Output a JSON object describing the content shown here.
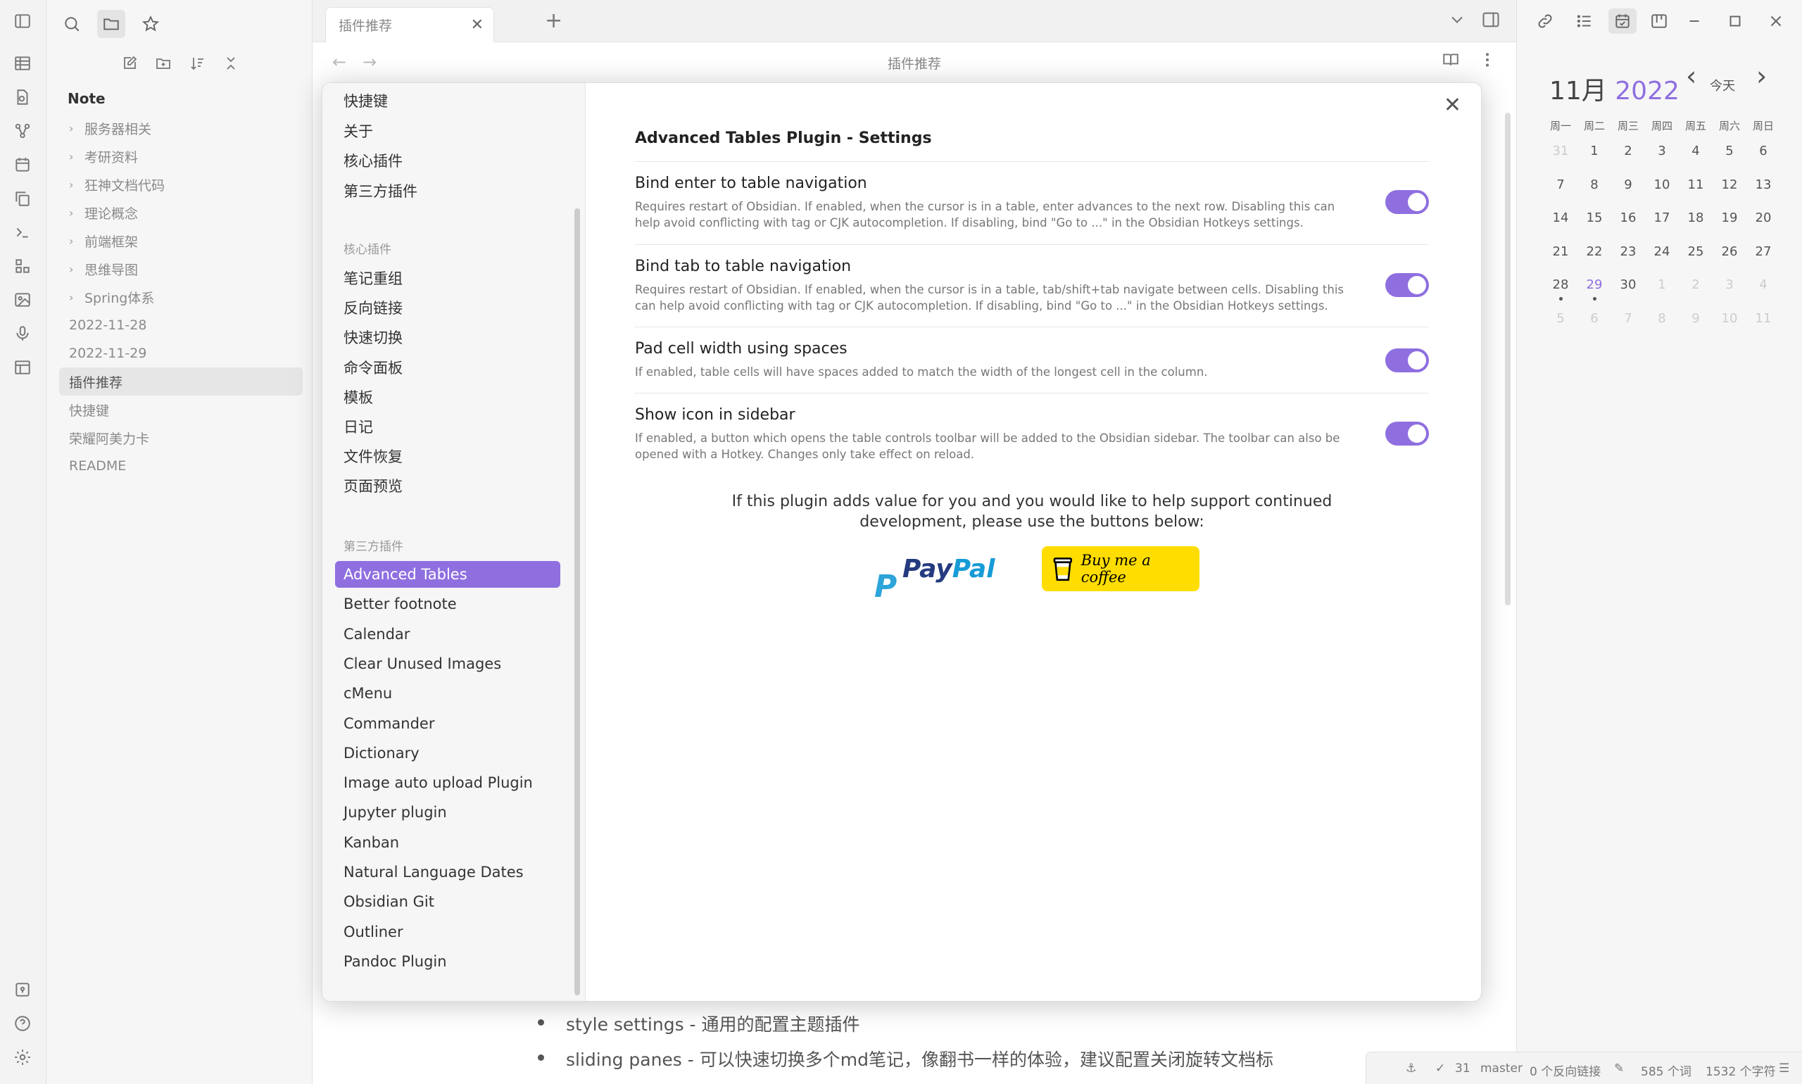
{
  "explorer": {
    "vault_name": "Note",
    "items": [
      {
        "label": "服务器相关",
        "folder": true
      },
      {
        "label": "考研资料",
        "folder": true
      },
      {
        "label": "狂神文档代码",
        "folder": true
      },
      {
        "label": "理论概念",
        "folder": true
      },
      {
        "label": "前端框架",
        "folder": true
      },
      {
        "label": "思维导图",
        "folder": true
      },
      {
        "label": "Spring体系",
        "folder": true
      },
      {
        "label": "2022-11-28",
        "folder": false
      },
      {
        "label": "2022-11-29",
        "folder": false
      },
      {
        "label": "插件推荐",
        "folder": false,
        "active": true
      },
      {
        "label": "快捷键",
        "folder": false
      },
      {
        "label": "荣耀阿美力卡",
        "folder": false
      },
      {
        "label": "README",
        "folder": false
      }
    ]
  },
  "tabbar": {
    "active_tab": "插件推荐",
    "close_glyph": "✕",
    "new_tab_glyph": "+"
  },
  "editor": {
    "doc_title": "插件推荐",
    "back_glyph": "←",
    "forward_glyph": "→",
    "bullets": [
      "style settings - 通用的配置主题插件",
      "sliding panes - 可以快速切换多个md笔记，像翻书一样的体验，建议配置关闭旋转文档标"
    ]
  },
  "settings": {
    "nav_top": [
      "快捷键",
      "关于",
      "核心插件",
      "第三方插件"
    ],
    "core_header": "核心插件",
    "core_items": [
      "笔记重组",
      "反向链接",
      "快速切换",
      "命令面板",
      "模板",
      "日记",
      "文件恢复",
      "页面预览"
    ],
    "community_header": "第三方插件",
    "community_items": [
      "Advanced Tables",
      "Better footnote",
      "Calendar",
      "Clear Unused Images",
      "cMenu",
      "Commander",
      "Dictionary",
      "Image auto upload Plugin",
      "Jupyter plugin",
      "Kanban",
      "Natural Language Dates",
      "Obsidian Git",
      "Outliner",
      "Pandoc Plugin"
    ],
    "active_item": "Advanced Tables",
    "close_glyph": "✕",
    "plugin_title": "Advanced Tables Plugin - Settings",
    "options": [
      {
        "name": "Bind enter to table navigation",
        "desc": "Requires restart of Obsidian. If enabled, when the cursor is in a table, enter advances to the next row. Disabling this can help avoid conflicting with tag or CJK autocompletion. If disabling, bind \"Go to ...\" in the Obsidian Hotkeys settings.",
        "enabled": true
      },
      {
        "name": "Bind tab to table navigation",
        "desc": "Requires restart of Obsidian. If enabled, when the cursor is in a table, tab/shift+tab navigate between cells. Disabling this can help avoid conflicting with tag or CJK autocompletion. If disabling, bind \"Go to ...\" in the Obsidian Hotkeys settings.",
        "enabled": true
      },
      {
        "name": "Pad cell width using spaces",
        "desc": "If enabled, table cells will have spaces added to match the width of the longest cell in the column.",
        "enabled": true
      },
      {
        "name": "Show icon in sidebar",
        "desc": "If enabled, a button which opens the table controls toolbar will be added to the Obsidian sidebar. The toolbar can also be opened with a Hotkey. Changes only take effect on reload.",
        "enabled": true
      }
    ],
    "support_line1": "If this plugin adds value for you and you would like to help support continued",
    "support_line2": "development, please use the buttons below:",
    "paypal_part1": "Pay",
    "paypal_part2": "Pal",
    "paypal_mark": "P",
    "coffee_label": "Buy me a coffee",
    "colors": {
      "accent": "#8f6fe0",
      "coffee_bg": "#ffdd00",
      "paypal_dark": "#253b80",
      "paypal_light": "#179bd7"
    }
  },
  "calendar": {
    "month": "11月",
    "year": "2022",
    "today_label": "今天",
    "prev_glyph": "‹",
    "next_glyph": "›",
    "weekdays": [
      "周一",
      "周二",
      "周三",
      "周四",
      "周五",
      "周六",
      "周日"
    ],
    "weeks": [
      [
        {
          "d": "31",
          "dim": true
        },
        {
          "d": "1"
        },
        {
          "d": "2"
        },
        {
          "d": "3"
        },
        {
          "d": "4"
        },
        {
          "d": "5"
        },
        {
          "d": "6"
        }
      ],
      [
        {
          "d": "7"
        },
        {
          "d": "8"
        },
        {
          "d": "9"
        },
        {
          "d": "10"
        },
        {
          "d": "11"
        },
        {
          "d": "12"
        },
        {
          "d": "13"
        }
      ],
      [
        {
          "d": "14"
        },
        {
          "d": "15"
        },
        {
          "d": "16"
        },
        {
          "d": "17"
        },
        {
          "d": "18"
        },
        {
          "d": "19"
        },
        {
          "d": "20"
        }
      ],
      [
        {
          "d": "21"
        },
        {
          "d": "22"
        },
        {
          "d": "23"
        },
        {
          "d": "24"
        },
        {
          "d": "25"
        },
        {
          "d": "26"
        },
        {
          "d": "27"
        }
      ],
      [
        {
          "d": "28",
          "dot": true
        },
        {
          "d": "29",
          "today": true,
          "dot": true
        },
        {
          "d": "30"
        },
        {
          "d": "1",
          "dim": true
        },
        {
          "d": "2",
          "dim": true
        },
        {
          "d": "3",
          "dim": true
        },
        {
          "d": "4",
          "dim": true
        }
      ],
      [
        {
          "d": "5",
          "dim": true
        },
        {
          "d": "6",
          "dim": true
        },
        {
          "d": "7",
          "dim": true
        },
        {
          "d": "8",
          "dim": true
        },
        {
          "d": "9",
          "dim": true
        },
        {
          "d": "10",
          "dim": true
        },
        {
          "d": "11",
          "dim": true
        }
      ]
    ]
  },
  "status": {
    "check_count": "31",
    "branch": "master",
    "backlinks": "0 个反向链接",
    "words": "585 个词",
    "chars": "1532 个字符"
  }
}
